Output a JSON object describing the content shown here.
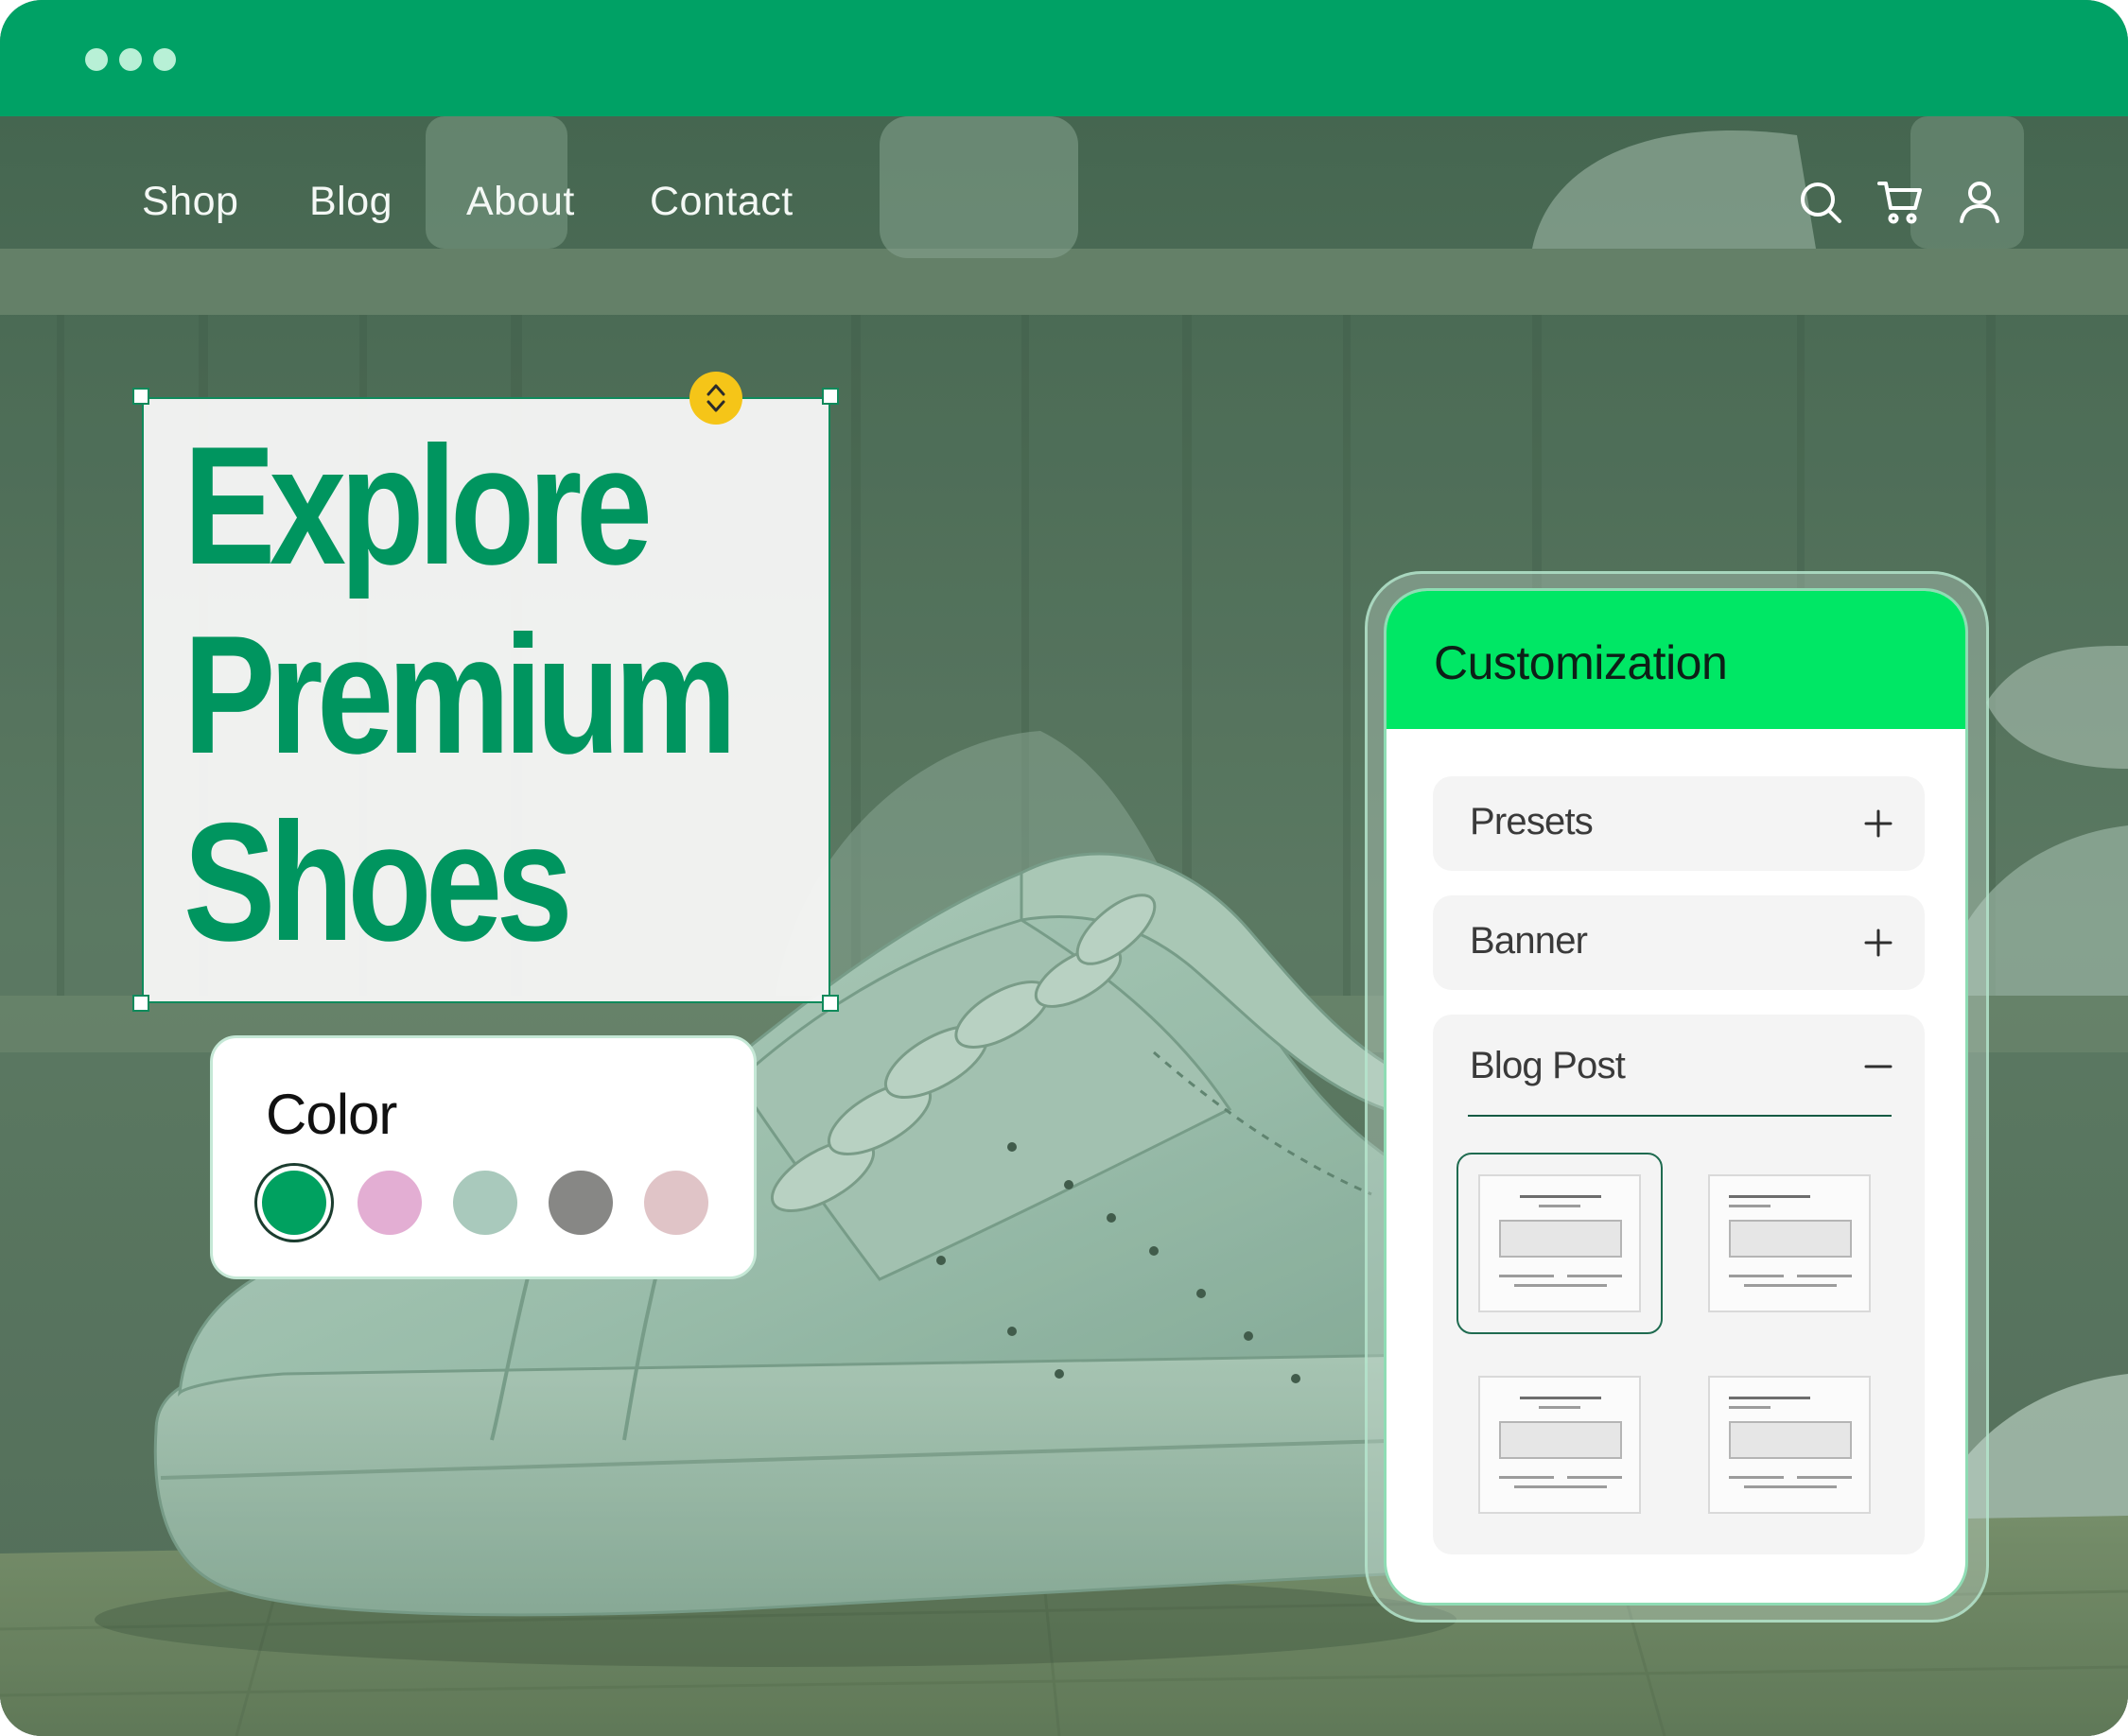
{
  "window": {
    "titlebar_color": "#00a165",
    "dots": [
      "window-dot",
      "window-dot",
      "window-dot"
    ]
  },
  "nav": {
    "links": [
      "Shop",
      "Blog",
      "About",
      "Contact"
    ],
    "icons": [
      "search-icon",
      "cart-icon",
      "user-icon"
    ]
  },
  "hero": {
    "line1": "Explore",
    "line2": "Premium",
    "line3": "Shoes",
    "text_color": "#00955f"
  },
  "color_picker": {
    "title": "Color",
    "swatches": [
      "#00a160",
      "#e3aed3",
      "#a9c9bc",
      "#878785",
      "#e0c4c7"
    ],
    "selected_index": 0
  },
  "customization": {
    "title": "Customization",
    "header_color": "#00e765",
    "items": [
      {
        "label": "Presets",
        "state": "collapsed"
      },
      {
        "label": "Banner",
        "state": "collapsed"
      },
      {
        "label": "Blog Post",
        "state": "expanded"
      }
    ],
    "blog_layouts": {
      "count": 4,
      "selected_index": 0
    }
  }
}
